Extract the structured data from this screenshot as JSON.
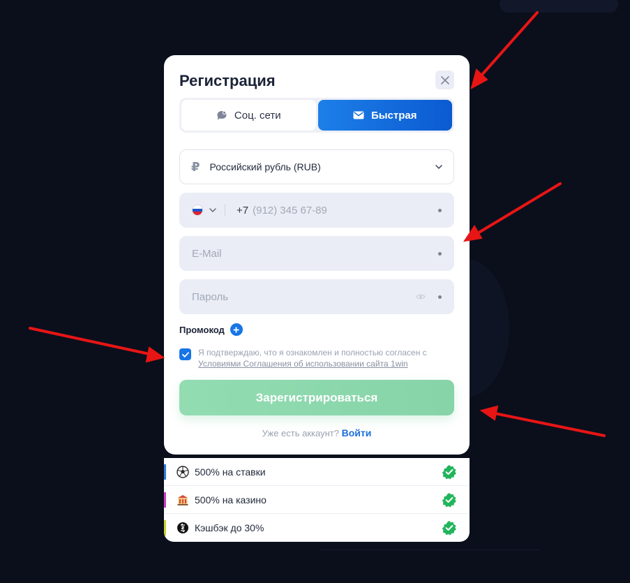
{
  "colors": {
    "accent": "#1775e5",
    "submit": "#8fd9ae",
    "check": "#22b55c",
    "annotation": "#e81515"
  },
  "modal": {
    "title": "Регистрация",
    "close_icon": "close-icon",
    "tabs": [
      {
        "label": "Соц. сети",
        "icon": "chat-bubble-icon",
        "active": false
      },
      {
        "label": "Быстрая",
        "icon": "envelope-icon",
        "active": true
      }
    ],
    "currency": {
      "symbol": "₽",
      "value": "Российский рубль (RUB)"
    },
    "phone": {
      "code": "+7",
      "placeholder": "(912) 345 67-89"
    },
    "email": {
      "placeholder": "E-Mail"
    },
    "password": {
      "placeholder": "Пароль"
    },
    "promo_label": "Промокод",
    "agreement": {
      "text": "Я подтверждаю, что я ознакомлен и полностью согласен с",
      "link": "Условиями Соглашения об использовании сайта 1win",
      "checked": true
    },
    "submit_label": "Зарегистрироваться",
    "login": {
      "question": "Уже есть аккаунт?",
      "link": "Войти"
    }
  },
  "bonuses": [
    {
      "label": "500% на ставки",
      "icon": "soccer-ball-icon",
      "bar": "#2e7fd6"
    },
    {
      "label": "500% на казино",
      "icon": "casino-icon",
      "bar": "#c940c7"
    },
    {
      "label": "Кэшбэк до 30%",
      "icon": "cashback-icon",
      "bar": "#c6d633"
    }
  ]
}
